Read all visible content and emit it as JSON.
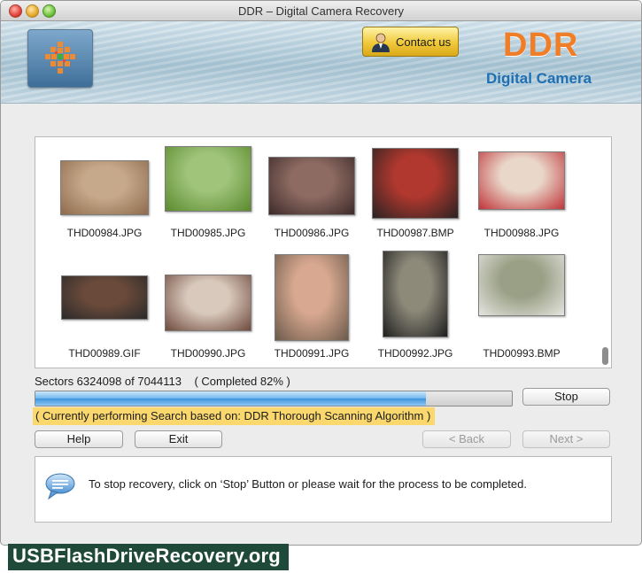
{
  "window": {
    "title": "DDR – Digital Camera Recovery"
  },
  "header": {
    "contact_label": "Contact us",
    "brand": "DDR",
    "product": "Digital Camera",
    "icons": [
      "app-logo-icon",
      "person-icon"
    ]
  },
  "thumbnails": [
    {
      "name": "THD00984.JPG",
      "colors": [
        "#c6a98a",
        "#8f6a4d"
      ]
    },
    {
      "name": "THD00985.JPG",
      "colors": [
        "#9fc47a",
        "#5b8a2e"
      ]
    },
    {
      "name": "THD00986.JPG",
      "colors": [
        "#8d6b62",
        "#3d2a2a"
      ]
    },
    {
      "name": "THD00987.BMP",
      "colors": [
        "#b1382e",
        "#2a2222"
      ]
    },
    {
      "name": "THD00988.JPG",
      "colors": [
        "#e9d7c9",
        "#c0343a"
      ]
    },
    {
      "name": "THD00989.GIF",
      "colors": [
        "#6a4a3a",
        "#2a2a2a"
      ]
    },
    {
      "name": "THD00990.JPG",
      "colors": [
        "#d9c9bd",
        "#6e4a3c"
      ]
    },
    {
      "name": "THD00991.JPG",
      "colors": [
        "#d8a890",
        "#6b5a4a"
      ]
    },
    {
      "name": "THD00992.JPG",
      "colors": [
        "#8d8a7a",
        "#1e1e1e"
      ]
    },
    {
      "name": "THD00993.BMP",
      "colors": [
        "#9aa086",
        "#e5e5e0"
      ]
    }
  ],
  "progress": {
    "sectors_label": "Sectors 6324098 of 7044113",
    "completed_label": "( Completed 82% )",
    "fraction": 0.82,
    "status": "( Currently performing Search based on: DDR Thorough Scanning Algorithm )"
  },
  "buttons": {
    "stop": "Stop",
    "help": "Help",
    "exit": "Exit",
    "back": "< Back",
    "next": "Next >"
  },
  "message": {
    "text": "To stop recovery, click on ‘Stop’ Button or please wait for the process to be completed.",
    "icon": "speech-bubble-icon"
  },
  "watermark": "USBFlashDriveRecovery.org",
  "colors": {
    "brand_orange": "#f07d28",
    "brand_blue": "#1f6fb3",
    "status_highlight": "#fbd86e",
    "progress_blue": "#3e93dc"
  }
}
